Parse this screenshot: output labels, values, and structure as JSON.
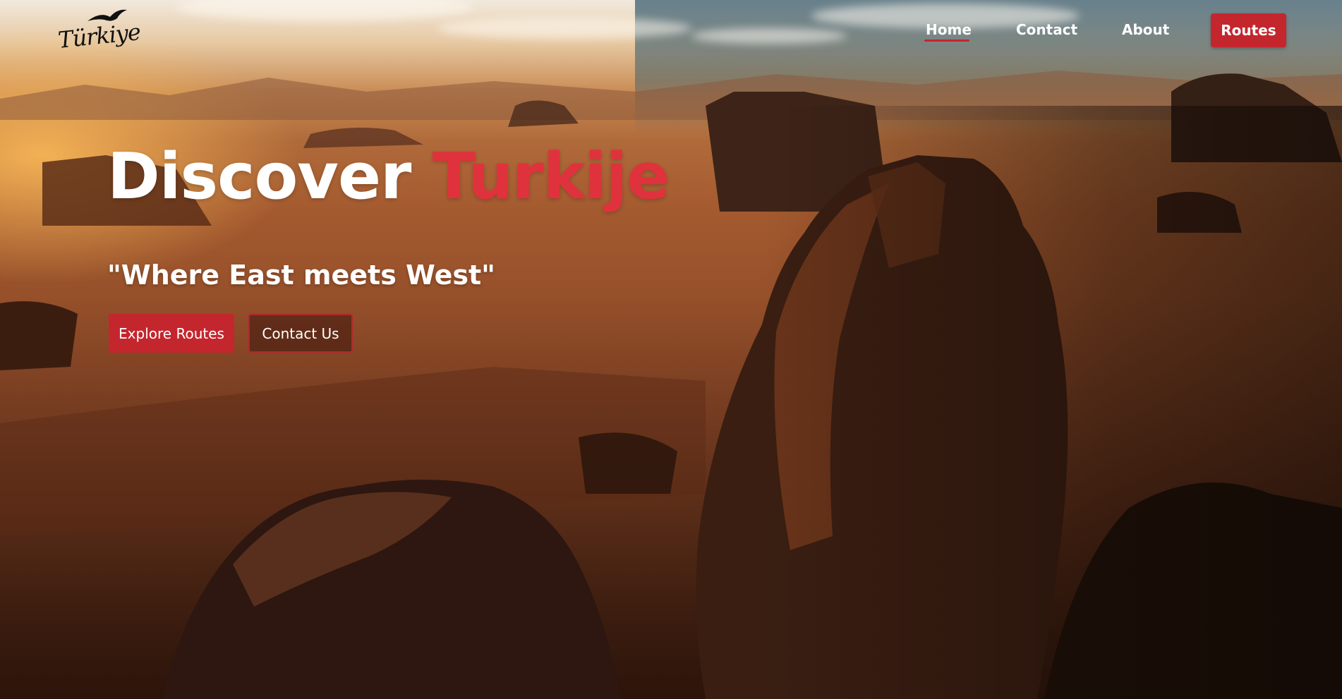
{
  "logo": {
    "text": "Türkiye",
    "icon": "bird-icon"
  },
  "nav": {
    "home": "Home",
    "contact": "Contact",
    "about": "About",
    "routes": "Routes"
  },
  "hero": {
    "headline_main": "Discover ",
    "headline_accent": "Turkije",
    "tagline": "\"Where East meets West\"",
    "primary_button": "Explore Routes",
    "secondary_button": "Contact Us"
  },
  "colors": {
    "accent_red": "#c4262e",
    "headline_red": "#e0323c",
    "text_white": "#ffffff"
  }
}
